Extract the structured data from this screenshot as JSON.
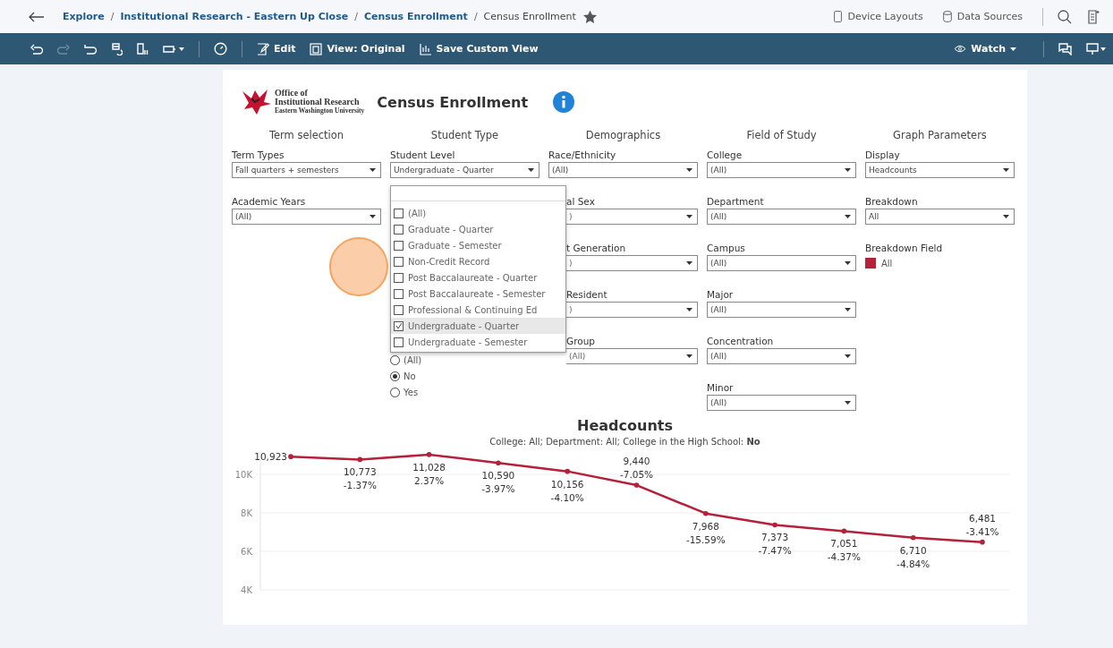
{
  "breadcrumb_separator": "/",
  "breadcrumb": [
    {
      "label": "Explore",
      "kind": "link"
    },
    {
      "label": "Institutional Research - Eastern Up Close",
      "kind": "link"
    },
    {
      "label": "Census Enrollment",
      "kind": "link"
    },
    {
      "label": "Census Enrollment",
      "kind": "current"
    }
  ],
  "header_actions": [
    "Device Layouts",
    "Data Sources"
  ],
  "toolbar": {
    "buttons": [
      "Edit",
      "View: Original",
      "Save Custom View"
    ],
    "watch": "Watch"
  },
  "dashboard": {
    "logo": [
      "Office of",
      "Institutional Research",
      "Eastern Washington University"
    ],
    "title": "Census Enrollment",
    "sections": [
      {
        "heading": "Term selection",
        "filters": [
          {
            "kind": "dropdown",
            "label": "Term Types",
            "value": "Fall quarters + semesters"
          },
          {
            "kind": "dropdown",
            "label": "Academic Years",
            "value": "(All)"
          }
        ]
      },
      {
        "heading": "Student Type",
        "filters": [
          {
            "kind": "dropdown",
            "label": "Student Level",
            "value": "Undergraduate - Quarter"
          },
          {
            "kind": "radio",
            "options": [
              {
                "label": "(All)",
                "selected": false
              },
              {
                "label": "No",
                "selected": true
              },
              {
                "label": "Yes",
                "selected": false
              }
            ]
          }
        ]
      },
      {
        "heading": "Demographics",
        "filters": [
          {
            "kind": "dropdown",
            "label": "Race/Ethnicity",
            "value": "(All)",
            "partial": false
          },
          {
            "kind": "dropdown",
            "label": "al Sex",
            "value": ")",
            "partial": true
          },
          {
            "kind": "dropdown",
            "label": "t Generation",
            "value": ")",
            "partial": true
          },
          {
            "kind": "dropdown",
            "label": "Resident",
            "value": ")",
            "partial": true
          },
          {
            "kind": "dropdown",
            "label": "Group",
            "value": "(All)",
            "partial": true
          }
        ]
      },
      {
        "heading": "Field of Study",
        "filters": [
          {
            "kind": "dropdown",
            "label": "College",
            "value": "(All)"
          },
          {
            "kind": "dropdown",
            "label": "Department",
            "value": "(All)"
          },
          {
            "kind": "dropdown",
            "label": "Campus",
            "value": "(All)"
          },
          {
            "kind": "dropdown",
            "label": "Major",
            "value": "(All)"
          },
          {
            "kind": "dropdown",
            "label": "Concentration",
            "value": "(All)"
          },
          {
            "kind": "dropdown",
            "label": "Minor",
            "value": "(All)"
          }
        ]
      },
      {
        "heading": "Graph Parameters",
        "filters": [
          {
            "kind": "dropdown",
            "label": "Display",
            "value": "Headcounts"
          },
          {
            "kind": "dropdown",
            "label": "Breakdown",
            "value": "All"
          },
          {
            "kind": "legend",
            "label": "Breakdown Field",
            "items": [
              {
                "label": "All",
                "color": "#b5203a"
              }
            ]
          }
        ]
      }
    ],
    "popup": {
      "items": [
        {
          "label": "(All)",
          "checked": false,
          "selected": false
        },
        {
          "label": "Graduate - Quarter",
          "checked": false,
          "selected": false
        },
        {
          "label": "Graduate - Semester",
          "checked": false,
          "selected": false
        },
        {
          "label": "Non-Credit Record",
          "checked": false,
          "selected": false
        },
        {
          "label": "Post Baccalaureate - Quarter",
          "checked": false,
          "selected": false
        },
        {
          "label": "Post Baccalaureate - Semester",
          "checked": false,
          "selected": false
        },
        {
          "label": "Professional & Continuing Ed",
          "checked": false,
          "selected": false
        },
        {
          "label": "Undergraduate - Quarter",
          "checked": true,
          "selected": true
        },
        {
          "label": "Undergraduate - Semester",
          "checked": false,
          "selected": false
        }
      ]
    },
    "chart": {
      "title": "Headcounts",
      "subtitle": "College: All; Department: All; College in the High School: **No**",
      "chart_data": {
        "type": "line",
        "grid": true,
        "ylim": [
          4000,
          11200
        ],
        "yticks": [
          {
            "value": 4000,
            "label": "4K"
          },
          {
            "value": 6000,
            "label": "6K"
          },
          {
            "value": 8000,
            "label": "8K"
          },
          {
            "value": 10000,
            "label": "10K"
          }
        ],
        "series": [
          {
            "color": "#b5203a",
            "values": [
              10923,
              10773,
              11028,
              10590,
              10156,
              9440,
              7968,
              7373,
              7051,
              6710,
              6481
            ]
          }
        ],
        "value_labels": [
          [
            "10,923"
          ],
          [
            "10,773",
            "-1.37%"
          ],
          [
            "11,028",
            "2.37%"
          ],
          [
            "10,590",
            "-3.97%"
          ],
          [
            "10,156",
            "-4.10%"
          ],
          [
            "9,440",
            "-7.05%"
          ],
          [
            "7,968",
            "-15.59%"
          ],
          [
            "7,373",
            "-7.47%"
          ],
          [
            "7,051",
            "-4.37%"
          ],
          [
            "6,710",
            "-4.84%"
          ],
          [
            "6,481",
            "-3.41%"
          ]
        ]
      }
    }
  }
}
